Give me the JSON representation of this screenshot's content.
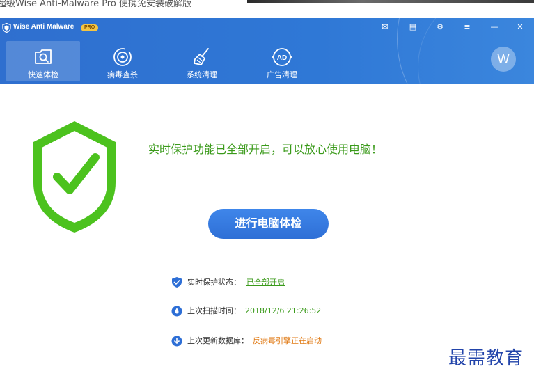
{
  "top_strip": {
    "text": "超级Wise Anti-Malware Pro 便携免安装破解版"
  },
  "app": {
    "title": "Wise Anti Malware",
    "badge": "PRO"
  },
  "titlebar_buttons": [
    {
      "name": "mail-icon",
      "glyph": "✉"
    },
    {
      "name": "message-icon",
      "glyph": "▤"
    },
    {
      "name": "tools-icon",
      "glyph": "⚙"
    },
    {
      "name": "menu-icon",
      "glyph": "≡"
    },
    {
      "name": "minimize-icon",
      "glyph": "—"
    },
    {
      "name": "close-icon",
      "glyph": "✕"
    }
  ],
  "nav": {
    "items": [
      {
        "label": "快速体检",
        "icon": "quick-scan-icon"
      },
      {
        "label": "病毒查杀",
        "icon": "virus-scan-icon"
      },
      {
        "label": "系统清理",
        "icon": "broom-icon"
      },
      {
        "label": "广告清理",
        "icon": "ad-icon",
        "icon_text": "AD"
      }
    ]
  },
  "avatar": {
    "initial": "W"
  },
  "main": {
    "status_message": "实时保护功能已全部开启，可以放心使用电脑！",
    "scan_button": "进行电脑体检"
  },
  "info": {
    "protection": {
      "label": "实时保护状态：",
      "value": "已全部开启"
    },
    "last_scan": {
      "label": "上次扫描时间：",
      "value": "2018/12/6 21:26:52"
    },
    "last_update": {
      "label": "上次更新数据库：",
      "value": "反病毒引擎正在启动"
    }
  },
  "watermark": {
    "text": "最需教育"
  },
  "colors": {
    "header": "#2f6fcf",
    "accent_green": "#3a9a1a",
    "shield_green": "#4cc21e",
    "button_blue": "#3578e0",
    "warning_orange": "#e07a14"
  }
}
